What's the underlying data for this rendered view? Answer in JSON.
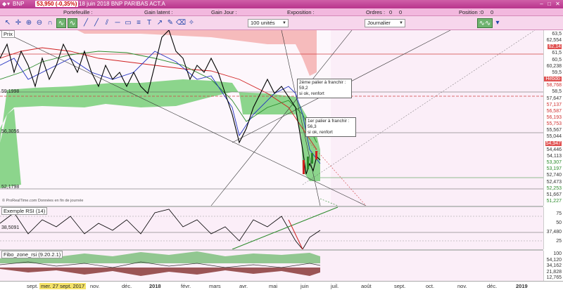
{
  "title_bar": {
    "ticker": "BNP",
    "price_change": "53,950 (-0,35%)",
    "date_name": "18 juin 2018 BNP PARIBAS ACT.A"
  },
  "info_bar": {
    "portefeuille": "Portefeuille :",
    "gain_latent": "Gain latent :",
    "gain_jour": "Gain Jour :",
    "exposition": "Exposition :",
    "ordres": "Ordres :",
    "ordres_val1": "0",
    "ordres_val2": "0",
    "position": "Position :",
    "position_val1": "0",
    "position_val2": "0"
  },
  "toolbar": {
    "units_dropdown": "100 unités",
    "period_dropdown": "Journalier"
  },
  "price_panel": {
    "label": "Prix",
    "left_values": [
      "59,1998",
      "56,3056",
      "52,1798"
    ],
    "notes": [
      "2ème palier à franchir : 59,2\nsi ok, renfort",
      "1er palier à franchir : 56,3\nsi ok, renfort"
    ],
    "watermark": "© ProRealTime.com  Données en fin de journée",
    "y_labels": [
      {
        "text": "63,5",
        "style": ""
      },
      {
        "text": "62,554",
        "style": ""
      },
      {
        "text": "62,14",
        "style": "red"
      },
      {
        "text": "61,5",
        "style": ""
      },
      {
        "text": "60,5",
        "style": ""
      },
      {
        "text": "60,238",
        "style": ""
      },
      {
        "text": "59,5",
        "style": ""
      },
      {
        "text": "Hebdo",
        "style": "hebdo"
      },
      {
        "text": "58,768",
        "style": "redtxt"
      },
      {
        "text": "58,5",
        "style": ""
      },
      {
        "text": "57,647",
        "style": ""
      },
      {
        "text": "57,137",
        "style": "redtxt"
      },
      {
        "text": "56,587",
        "style": "redtxt"
      },
      {
        "text": "56,193",
        "style": "redtxt"
      },
      {
        "text": "55,753",
        "style": "redtxt"
      },
      {
        "text": "55,567",
        "style": ""
      },
      {
        "text": "55,044",
        "style": ""
      },
      {
        "text": "54,947",
        "style": "red"
      },
      {
        "text": "54,446",
        "style": ""
      },
      {
        "text": "54,113",
        "style": ""
      },
      {
        "text": "53,307",
        "style": "green"
      },
      {
        "text": "53,197",
        "style": "green"
      },
      {
        "text": "52,740",
        "style": ""
      },
      {
        "text": "52,473",
        "style": ""
      },
      {
        "text": "52,253",
        "style": "green"
      },
      {
        "text": "51,667",
        "style": ""
      },
      {
        "text": "51,227",
        "style": "green"
      }
    ]
  },
  "rsi_panel": {
    "label": "Exemple RSI (14)",
    "left_value": "38,5091",
    "y_labels": [
      "75",
      "50",
      "37,480",
      "25"
    ]
  },
  "fibo_panel": {
    "label": "Fibo_zone_rsi (9.20.2.1)",
    "y_labels": [
      "100",
      "54,120",
      "34,162",
      "21,828",
      "12,765"
    ]
  },
  "x_axis": {
    "labels": [
      {
        "text": "sept.",
        "style": ""
      },
      {
        "text": "mer. 27 sept. 2017",
        "style": "hl"
      },
      {
        "text": "nov.",
        "style": ""
      },
      {
        "text": "déc.",
        "style": ""
      },
      {
        "text": "2018",
        "style": "bold"
      },
      {
        "text": "févr.",
        "style": ""
      },
      {
        "text": "mars",
        "style": ""
      },
      {
        "text": "avr.",
        "style": ""
      },
      {
        "text": "mai",
        "style": ""
      },
      {
        "text": "juin",
        "style": ""
      },
      {
        "text": "juil.",
        "style": ""
      },
      {
        "text": "août",
        "style": ""
      },
      {
        "text": "sept.",
        "style": ""
      },
      {
        "text": "oct.",
        "style": ""
      },
      {
        "text": "nov.",
        "style": ""
      },
      {
        "text": "déc.",
        "style": ""
      },
      {
        "text": "2019",
        "style": "bold"
      }
    ]
  },
  "colors": {
    "title_bg": "#c0409a",
    "info_bg": "#f2b8de",
    "cloud_green": "#7fd07f",
    "cloud_red": "#f5b0b0",
    "price_line": "#000000"
  }
}
